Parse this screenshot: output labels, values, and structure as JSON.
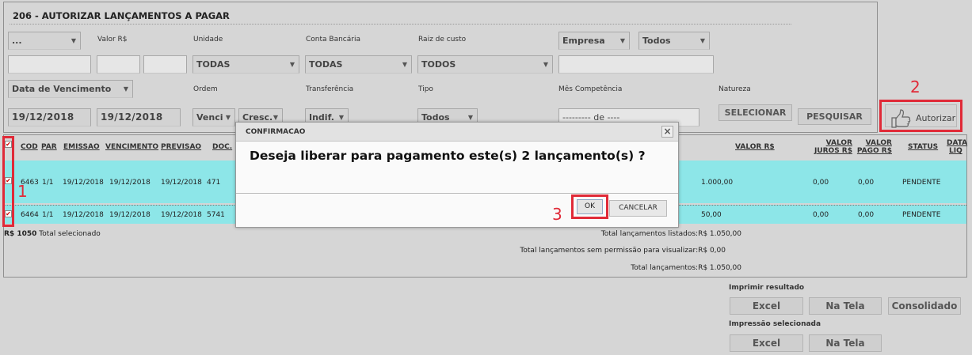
{
  "form": {
    "title": "206 - AUTORIZAR LANÇAMENTOS A PAGAR",
    "labels": {
      "valor": "Valor R$",
      "unidade": "Unidade",
      "conta": "Conta Bancária",
      "raiz": "Raiz de custo",
      "ordem": "Ordem",
      "transferencia": "Transferência",
      "tipo": "Tipo",
      "mes": "Mês Competência",
      "natureza": "Natureza"
    },
    "selects": {
      "first": "...",
      "empresa": "Empresa",
      "todos_empresa": "Todos",
      "unidade": "TODAS",
      "conta": "TODAS",
      "raiz": "TODOS",
      "data_tipo": "Data de Vencimento",
      "ordem": "Venci",
      "direcao": "Cresc.",
      "transferencia": "Indif.",
      "tipo": "Todos"
    },
    "dates": {
      "inicio": "19/12/2018",
      "fim": "19/12/2018"
    },
    "mes_placeholder": "--------- de ----",
    "buttons": {
      "selecionar": "SELECIONAR",
      "pesquisar": "PESQUISAR",
      "autorizar": "Autorizar"
    }
  },
  "annotations": {
    "n1": "1",
    "n2": "2",
    "n3": "3"
  },
  "table": {
    "headers": {
      "cod": "COD",
      "par": "PAR",
      "emissao": "EMISSAO",
      "vencimento": "VENCIMENTO",
      "previsao": "PREVISAO",
      "doc": "DOC.",
      "valor": "VALOR R$",
      "juros1": "VALOR",
      "juros2": "JUROS R$",
      "pago1": "VALOR",
      "pago2": "PAGO R$",
      "status": "STATUS",
      "data1": "DATA",
      "data2": "LIQ"
    },
    "rows": [
      {
        "cod": "6463",
        "par": "1/1",
        "emissao": "19/12/2018",
        "vencimento": "19/12/2018",
        "previsao": "19/12/2018",
        "doc": "471",
        "valor": "1.000,00",
        "juros": "0,00",
        "pago": "0,00",
        "status": "PENDENTE"
      },
      {
        "cod": "6464",
        "par": "1/1",
        "emissao": "19/12/2018",
        "vencimento": "19/12/2018",
        "previsao": "19/12/2018",
        "doc": "5741",
        "valor": "50,00",
        "juros": "0,00",
        "pago": "0,00",
        "status": "PENDENTE"
      }
    ],
    "selected_amount": "R$ 1050",
    "selected_label": "Total selecionado",
    "totals": {
      "listados_label": "Total lançamentos listados:",
      "listados_value": "R$ 1.050,00",
      "sem_perm_label": "Total lançamentos sem permissão para visualizar:",
      "sem_perm_value": "R$ 0,00",
      "total_label": "Total lançamentos:",
      "total_value": "R$ 1.050,00"
    }
  },
  "modal": {
    "title": "CONFIRMACAO",
    "close": "×",
    "message": "Deseja liberar para pagamento este(s) 2 lançamento(s) ?",
    "ok": "OK",
    "cancel": "CANCELAR"
  },
  "print": {
    "result_label": "Imprimir resultado",
    "excel": "Excel",
    "natela": "Na Tela",
    "consolidado": "Consolidado",
    "selected_label": "Impressão selecionada",
    "excel2": "Excel",
    "natela2": "Na Tela"
  }
}
